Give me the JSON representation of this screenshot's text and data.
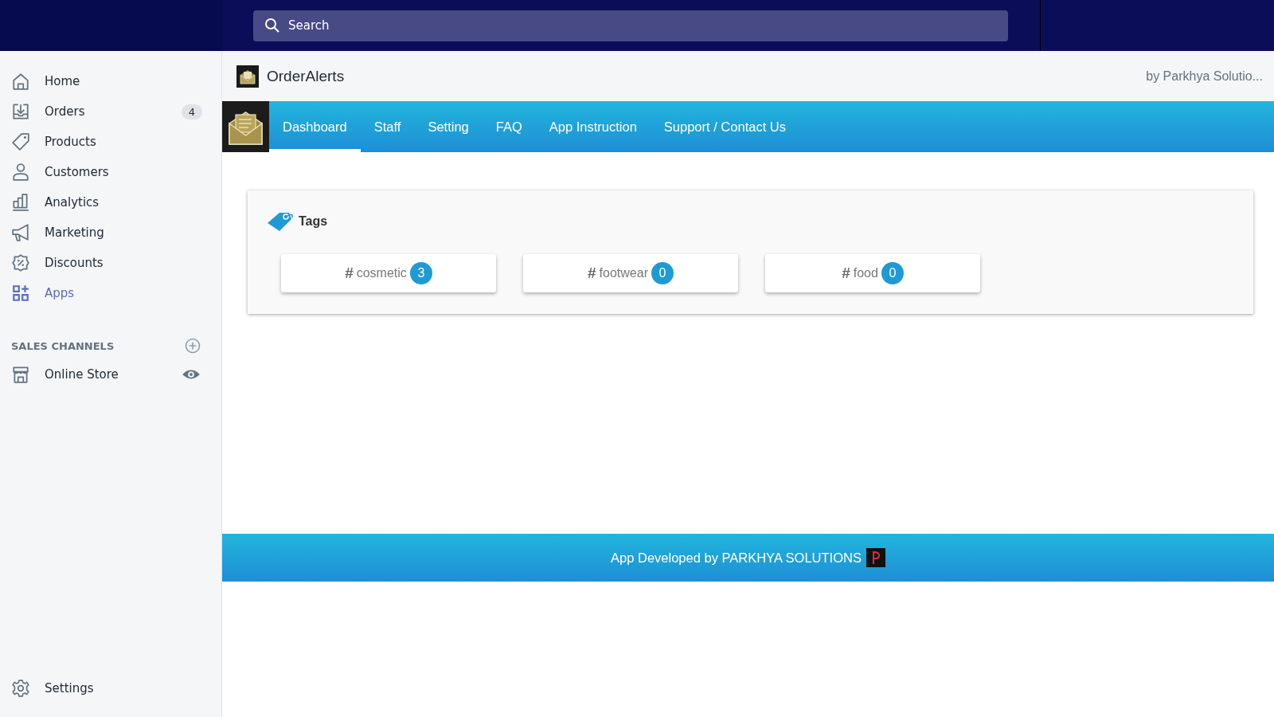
{
  "top_bar": {
    "search": {
      "placeholder": "Search"
    }
  },
  "sidebar": {
    "items": [
      {
        "label": "Home",
        "selected": false
      },
      {
        "label": "Orders",
        "selected": false,
        "badge": "4"
      },
      {
        "label": "Products",
        "selected": false
      },
      {
        "label": "Customers",
        "selected": false
      },
      {
        "label": "Analytics",
        "selected": false
      },
      {
        "label": "Marketing",
        "selected": false
      },
      {
        "label": "Discounts",
        "selected": false
      },
      {
        "label": "Apps",
        "selected": true
      }
    ],
    "sales_channels": {
      "heading": "SALES CHANNELS",
      "items": [
        {
          "label": "Online Store"
        }
      ]
    },
    "settings": {
      "label": "Settings"
    }
  },
  "app_header": {
    "title": "OrderAlerts",
    "by": "by Parkhya Solutio..."
  },
  "tabs": [
    {
      "label": "Dashboard",
      "selected": true
    },
    {
      "label": "Staff",
      "selected": false
    },
    {
      "label": "Setting",
      "selected": false
    },
    {
      "label": "FAQ",
      "selected": false
    },
    {
      "label": "App Instruction",
      "selected": false
    },
    {
      "label": "Support / Contact Us",
      "selected": false
    }
  ],
  "tags_panel": {
    "title": "Tags",
    "tags": [
      {
        "hash": "#",
        "name": "cosmetic",
        "count": "3"
      },
      {
        "hash": "#",
        "name": "footwear",
        "count": "0"
      },
      {
        "hash": "#",
        "name": "food",
        "count": "0"
      }
    ]
  },
  "footer": {
    "text": "App Developed by PARKHYA SOLUTIONS"
  }
}
